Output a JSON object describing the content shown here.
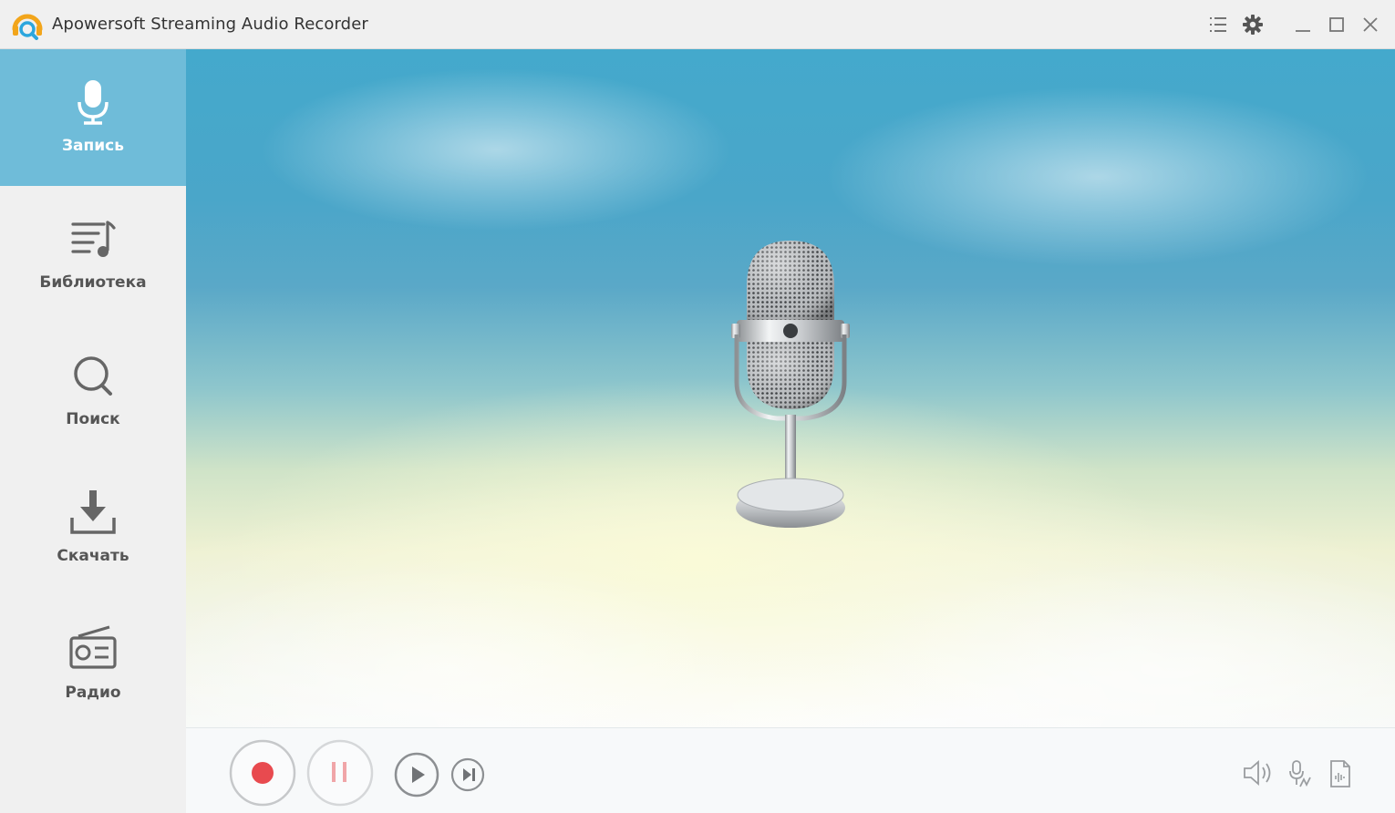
{
  "window": {
    "title": "Apowersoft Streaming Audio Recorder",
    "logo_icon": "headphones-search-logo",
    "controls": [
      {
        "name": "menu-list-icon"
      },
      {
        "name": "gear-icon"
      },
      {
        "name": "minimize-icon"
      },
      {
        "name": "maximize-icon"
      },
      {
        "name": "close-icon"
      }
    ]
  },
  "sidebar": {
    "items": [
      {
        "label": "Запись",
        "icon": "microphone-icon",
        "active": true
      },
      {
        "label": "Библиотека",
        "icon": "music-list-icon",
        "active": false
      },
      {
        "label": "Поиск",
        "icon": "search-icon",
        "active": false
      },
      {
        "label": "Скачать",
        "icon": "download-icon",
        "active": false
      },
      {
        "label": "Радио",
        "icon": "radio-icon",
        "active": false
      }
    ]
  },
  "colors": {
    "sidebar_bg": "#f0f0f0",
    "active_item": "#6fbcd9",
    "record_red": "#e84a4f",
    "pause_pink": "#f0a5a8"
  },
  "controls": {
    "buttons": [
      "record-icon",
      "pause-icon",
      "play-icon",
      "next-track-icon",
      "speaker-icon",
      "audio-source-icon",
      "audio-file-icon"
    ]
  }
}
